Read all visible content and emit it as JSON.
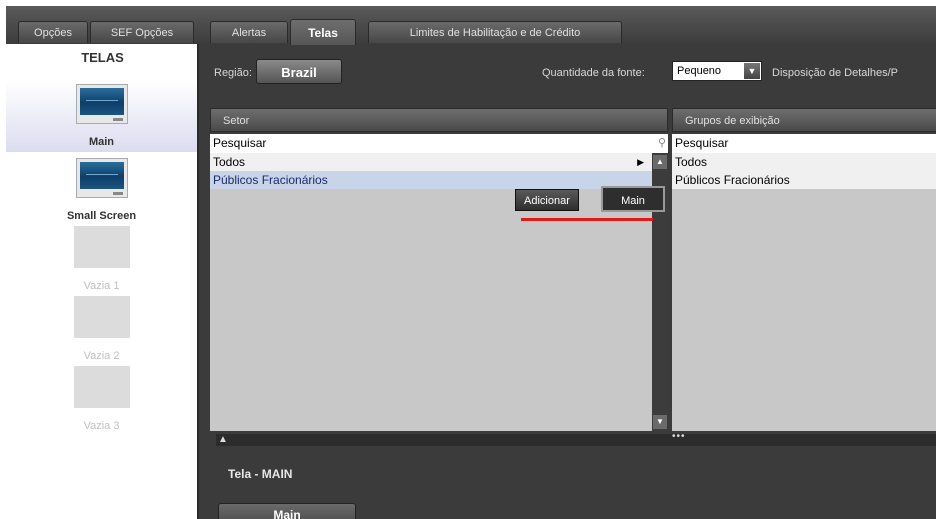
{
  "tabs": [
    {
      "label": "Opções",
      "active": false
    },
    {
      "label": "SEF Opções",
      "active": false
    },
    {
      "label": "Alertas",
      "active": false
    },
    {
      "label": "Telas",
      "active": true
    },
    {
      "label": "Limites de Habilitação e de Crédito",
      "active": false
    }
  ],
  "sidebar": {
    "title": "TELAS",
    "screens": [
      {
        "label": "Main",
        "selected": true,
        "icon": "monitor-icon"
      },
      {
        "label": "Small Screen",
        "selected": false,
        "icon": "monitor-icon"
      },
      {
        "label": "Vazia 1",
        "selected": false,
        "icon": "empty-slot"
      },
      {
        "label": "Vazia 2",
        "selected": false,
        "icon": "empty-slot"
      },
      {
        "label": "Vazia 3",
        "selected": false,
        "icon": "empty-slot"
      }
    ]
  },
  "toolbar": {
    "region_label": "Região:",
    "region_value": "Brazil",
    "font_label": "Quantidade da fonte:",
    "font_value": "Pequeno",
    "layout_label": "Disposição de Detalhes/P"
  },
  "sector_panel": {
    "header": "Setor",
    "search_placeholder": "Pesquisar",
    "items": [
      "Todos",
      "Públicos Fracionários"
    ]
  },
  "groups_panel": {
    "header": "Grupos de exibição",
    "search_placeholder": "Pesquisar",
    "items": [
      "Todos",
      "Públicos Fracionários"
    ]
  },
  "context_menu": {
    "add_label": "Adicionar",
    "submenu_label": "Main"
  },
  "bottom": {
    "screen_title": "Tela - MAIN",
    "tab_label": "Main"
  },
  "colors": {
    "frame_bg": "#3b3b3b",
    "list_bg": "#c8c8c8",
    "selected_row": "#c8d4e8",
    "highlight_underline": "#e01818"
  }
}
